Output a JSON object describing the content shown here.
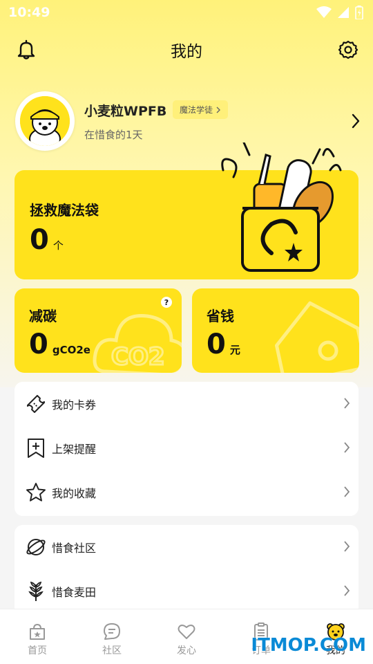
{
  "status_bar": {
    "time": "10:49"
  },
  "header": {
    "title": "我的"
  },
  "profile": {
    "username": "小麦粒WPFB",
    "level_badge": "魔法学徒",
    "days": "在惜食的1天"
  },
  "rescue_card": {
    "title": "拯救魔法袋",
    "value": "0",
    "unit": "个"
  },
  "carbon_card": {
    "title": "减碳",
    "value": "0",
    "unit": "gCO2e",
    "help": "?",
    "watermark_text": "CO2"
  },
  "money_card": {
    "title": "省钱",
    "value": "0",
    "unit": "元"
  },
  "menu_group_1": {
    "items": [
      {
        "label": "我的卡券",
        "icon": "ticket-icon"
      },
      {
        "label": "上架提醒",
        "icon": "bookmark-plus-icon"
      },
      {
        "label": "我的收藏",
        "icon": "star-icon"
      }
    ]
  },
  "menu_group_2": {
    "items": [
      {
        "label": "惜食社区",
        "icon": "planet-icon"
      },
      {
        "label": "惜食麦田",
        "icon": "wheat-icon"
      }
    ]
  },
  "tabbar": {
    "tabs": [
      {
        "label": "首页",
        "icon": "bag-icon",
        "active": false
      },
      {
        "label": "社区",
        "icon": "chat-icon",
        "active": false
      },
      {
        "label": "发心",
        "icon": "heart-icon",
        "active": false
      },
      {
        "label": "订单",
        "icon": "clipboard-icon",
        "active": false
      },
      {
        "label": "我的",
        "icon": "bear-icon",
        "active": true
      }
    ]
  },
  "watermark": "ITMOP.COM",
  "colors": {
    "accent": "#ffe21c",
    "background": "#f5f5f5"
  }
}
